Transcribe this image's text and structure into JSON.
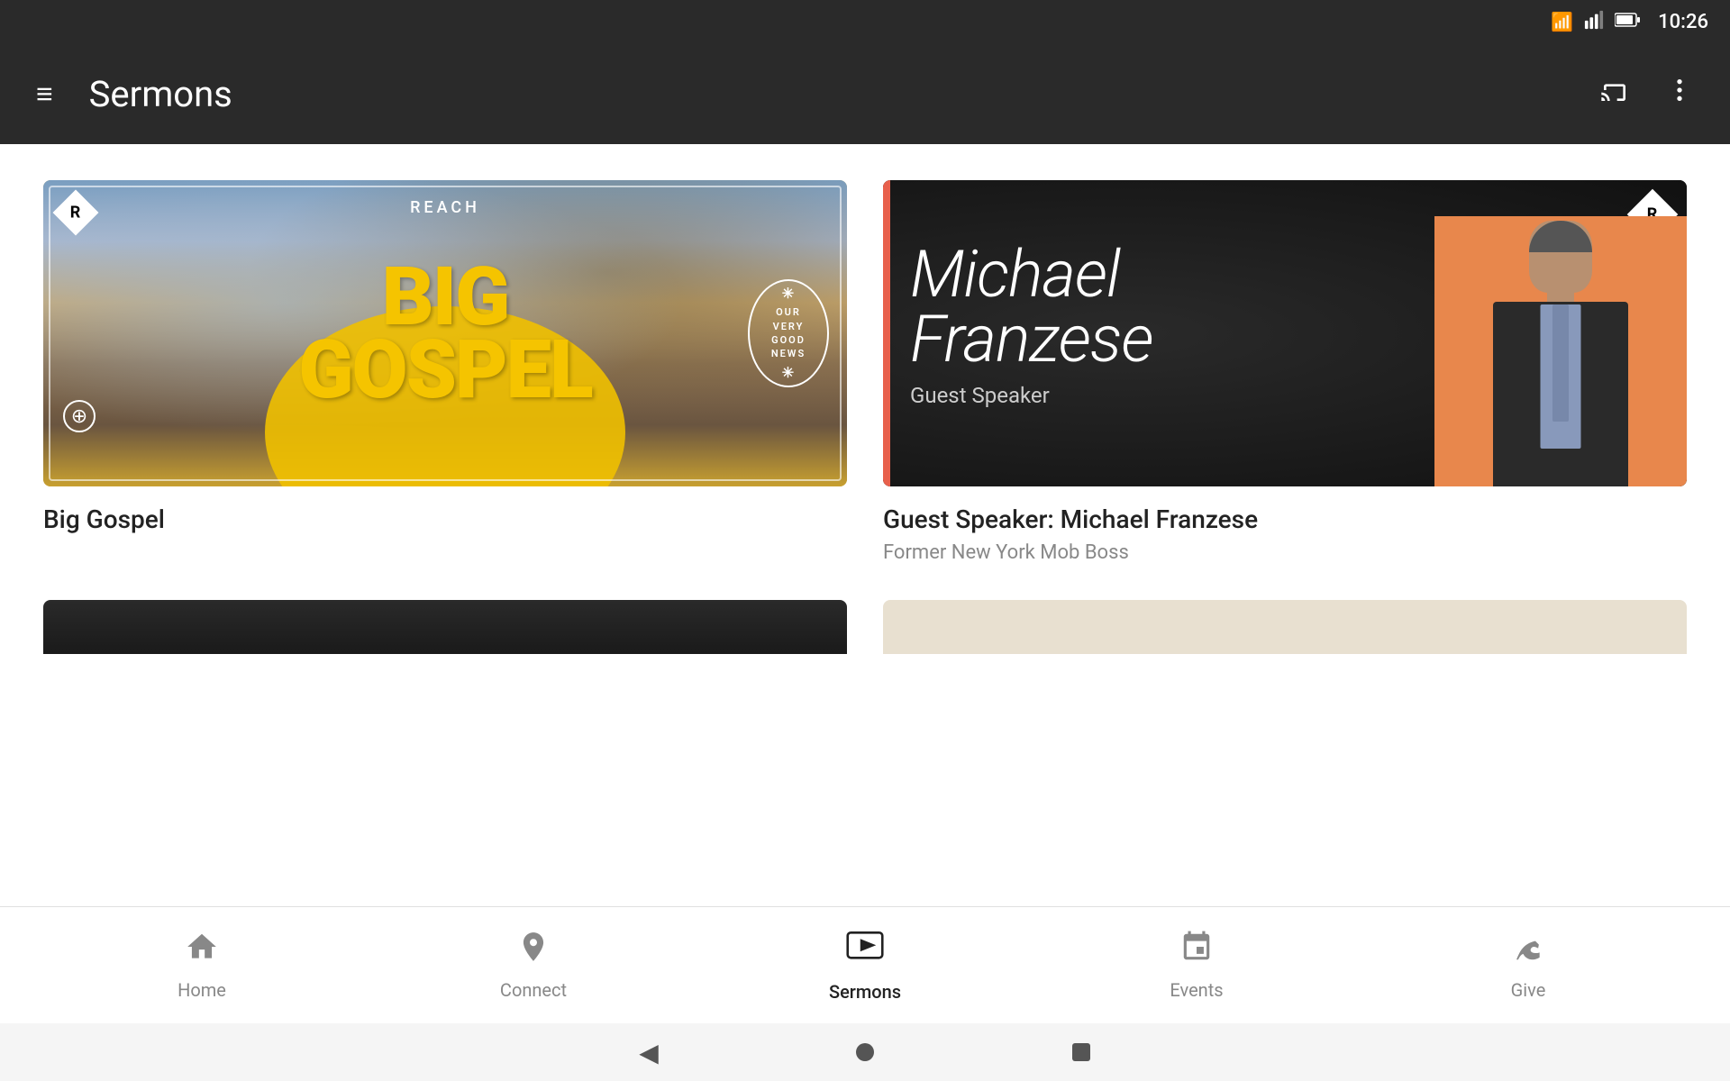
{
  "statusBar": {
    "time": "10:26",
    "wifiIcon": "wifi",
    "signalIcon": "signal",
    "batteryIcon": "battery"
  },
  "appBar": {
    "menuIcon": "≡",
    "title": "Sermons",
    "castIcon": "⧉",
    "moreIcon": "⋮"
  },
  "cards": [
    {
      "id": "big-gospel",
      "title": "Big Gospel",
      "subtitle": "",
      "thumbnailLabel": "BIG GOSPEL",
      "seriesLabel": "REACH",
      "ovalText": "OUR\nVERY\nGOOD\nNEWS"
    },
    {
      "id": "franzese",
      "title": "Guest Speaker: Michael Franzese",
      "subtitle": "Former New York Mob Boss",
      "nameFirst": "Michael",
      "nameLast": "Franzese",
      "speakerLabel": "Guest Speaker"
    }
  ],
  "bottomNav": {
    "items": [
      {
        "id": "home",
        "label": "Home",
        "icon": "🏠",
        "active": false
      },
      {
        "id": "connect",
        "label": "Connect",
        "icon": "📍",
        "active": false
      },
      {
        "id": "sermons",
        "label": "Sermons",
        "icon": "▶",
        "active": true
      },
      {
        "id": "events",
        "label": "Events",
        "icon": "📅",
        "active": false
      },
      {
        "id": "give",
        "label": "Give",
        "icon": "🤲",
        "active": false
      }
    ]
  },
  "systemNav": {
    "backLabel": "◀",
    "homeLabel": "●",
    "recentLabel": "■"
  }
}
